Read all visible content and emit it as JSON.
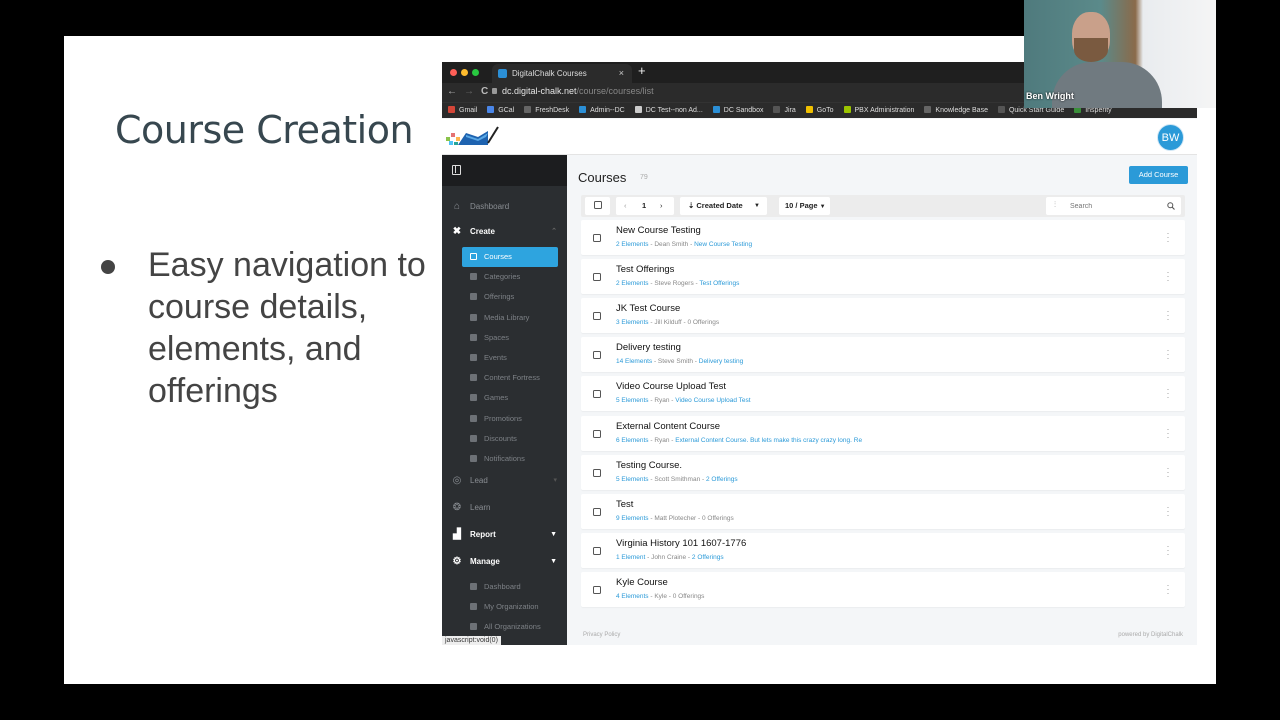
{
  "slide": {
    "title": "Course Creation",
    "bullets": [
      "Easy navigation to course details, elements, and offerings"
    ]
  },
  "browser": {
    "tab_title": "DigitalChalk Courses",
    "tab_close": "×",
    "new_tab": "+",
    "url_domain": "dc.digital-chalk.net",
    "url_path": "/course/courses/list",
    "nav": {
      "back": "←",
      "forward": "→",
      "reload": "C"
    },
    "bookmarks": [
      {
        "label": "Gmail",
        "color": "#d44638"
      },
      {
        "label": "GCal",
        "color": "#4a86e8"
      },
      {
        "label": "FreshDesk",
        "color": "#666666"
      },
      {
        "label": "Admin--DC",
        "color": "#2b8fd6"
      },
      {
        "label": "DC Test--non Ad...",
        "color": "#cccccc"
      },
      {
        "label": "DC Sandbox",
        "color": "#2b8fd6"
      },
      {
        "label": "Jira",
        "color": "#555555"
      },
      {
        "label": "GoTo",
        "color": "#f0c000"
      },
      {
        "label": "PBX Administration",
        "color": "#9bc400"
      },
      {
        "label": "Knowledge Base",
        "color": "#666666"
      },
      {
        "label": "Quick Start Guide",
        "color": "#555555"
      },
      {
        "label": "Insperity",
        "color": "#3a8f3a"
      }
    ],
    "status_url": "javascript:void(0)"
  },
  "app": {
    "avatar_initials": "BW",
    "sidebar": {
      "items": [
        {
          "label": "Dashboard",
          "icon": "home-icon"
        },
        {
          "label": "Create",
          "icon": "tools-icon"
        },
        {
          "label": "Lead",
          "icon": "target-icon"
        },
        {
          "label": "Learn",
          "icon": "brain-icon"
        },
        {
          "label": "Report",
          "icon": "bar-chart-icon"
        },
        {
          "label": "Manage",
          "icon": "gear-icon"
        }
      ],
      "create_sub": [
        "Courses",
        "Categories",
        "Offerings",
        "Media Library",
        "Spaces",
        "Events",
        "Content Fortress",
        "Games",
        "Promotions",
        "Discounts",
        "Notifications"
      ],
      "manage_sub": [
        "Dashboard",
        "My Organization",
        "All Organizations"
      ]
    },
    "main": {
      "title": "Courses",
      "count": "79",
      "add_button": "Add Course",
      "toolbar": {
        "prev": "‹",
        "page": "1",
        "next": "›",
        "sort_label": "Created Date",
        "per_page": "10 / Page",
        "search_placeholder": "Search"
      },
      "courses": [
        {
          "title": "New Course Testing",
          "elements": "2 Elements",
          "author": "Dean Smith",
          "offerings": "New Course Testing",
          "offerings_link": true
        },
        {
          "title": "Test Offerings",
          "elements": "2 Elements",
          "author": "Steve Rogers",
          "offerings": "Test Offerings",
          "offerings_link": true
        },
        {
          "title": "JK Test Course",
          "elements": "3 Elements",
          "author": "Jill Kilduff",
          "offerings": "0 Offerings",
          "offerings_link": false
        },
        {
          "title": "Delivery testing",
          "elements": "14 Elements",
          "author": "Steve Smith",
          "offerings": "Delivery testing",
          "offerings_link": true
        },
        {
          "title": "Video Course Upload Test",
          "elements": "5 Elements",
          "author": "Ryan",
          "offerings": "Video Course Upload Test",
          "offerings_link": true
        },
        {
          "title": "External Content Course",
          "elements": "6 Elements",
          "author": "Ryan",
          "offerings": "External Content Course. But lets make this crazy crazy long. Re",
          "offerings_link": true
        },
        {
          "title": "Testing Course.",
          "elements": "5 Elements",
          "author": "Scott Smithman",
          "offerings": "2 Offerings",
          "offerings_link": true
        },
        {
          "title": "Test",
          "elements": "9 Elements",
          "author": "Matt Plotecher",
          "offerings": "0 Offerings",
          "offerings_link": false
        },
        {
          "title": "Virginia History 101 1607-1776",
          "elements": "1 Element",
          "author": "John Craine",
          "offerings": "2 Offerings",
          "offerings_link": true
        },
        {
          "title": "Kyle Course",
          "elements": "4 Elements",
          "author": "Kyle",
          "offerings": "0 Offerings",
          "offerings_link": false
        }
      ],
      "footer_left": "Privacy Policy",
      "footer_right": "powered by DigitalChalk"
    }
  },
  "webcam": {
    "name": "Ben Wright"
  }
}
